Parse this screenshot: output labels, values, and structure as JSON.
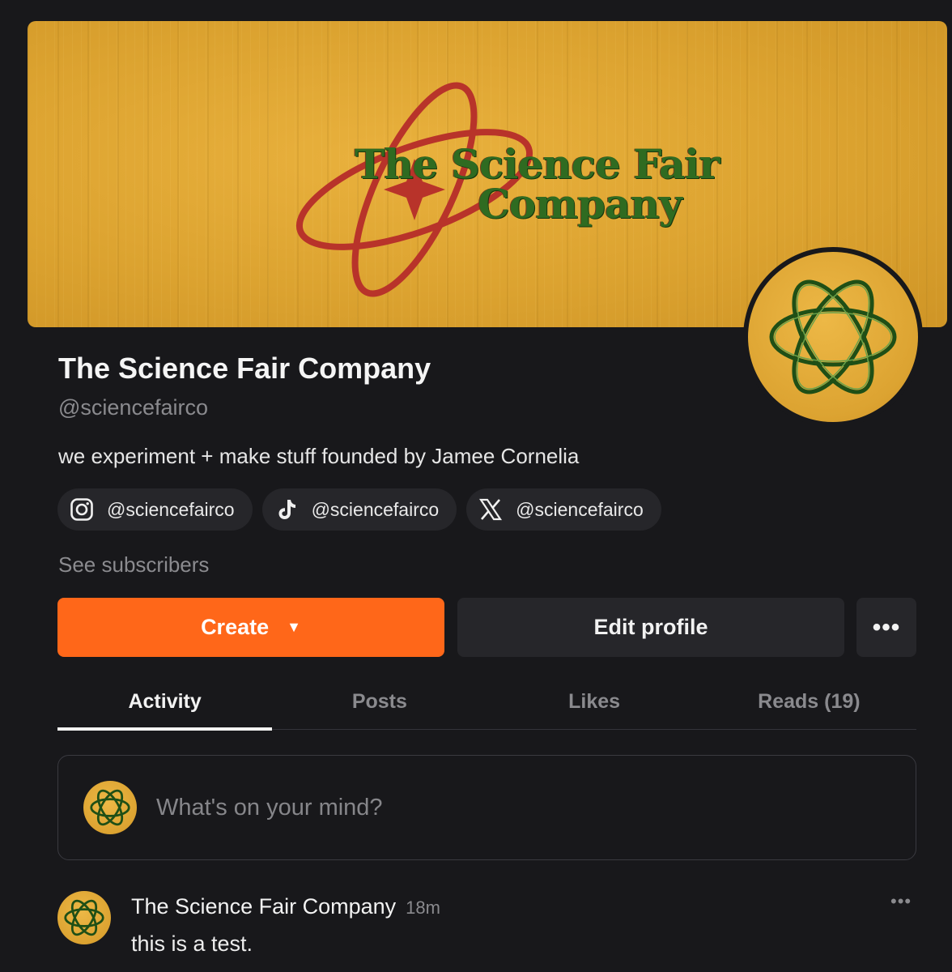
{
  "banner": {
    "logo_line1": "The Science Fair",
    "logo_line2": "Company",
    "colors": {
      "background": "#dca330",
      "text": "#2f6b21",
      "orbit": "#b8332a"
    }
  },
  "profile": {
    "name": "The Science Fair Company",
    "handle": "@sciencefairco",
    "bio": "we experiment + make stuff founded by Jamee Cornelia",
    "avatar_icon": "atom-orbit-logo"
  },
  "socials": [
    {
      "icon": "instagram-icon",
      "label": "@sciencefairco"
    },
    {
      "icon": "tiktok-icon",
      "label": "@sciencefairco"
    },
    {
      "icon": "x-icon",
      "label": "@sciencefairco"
    }
  ],
  "see_subscribers": "See subscribers",
  "actions": {
    "create_label": "Create",
    "create_caret": "▼",
    "edit_label": "Edit profile",
    "more_label": "•••"
  },
  "tabs": [
    {
      "label": "Activity",
      "active": true
    },
    {
      "label": "Posts",
      "active": false
    },
    {
      "label": "Likes",
      "active": false
    },
    {
      "label": "Reads (19)",
      "active": false
    }
  ],
  "composer": {
    "placeholder": "What's on your mind?"
  },
  "post": {
    "author": "The Science Fair Company",
    "time": "18m",
    "text": "this is a test.",
    "more_label": "•••"
  },
  "colors": {
    "accent": "#ff6719",
    "bg": "#18181b",
    "surface": "#26262a"
  }
}
